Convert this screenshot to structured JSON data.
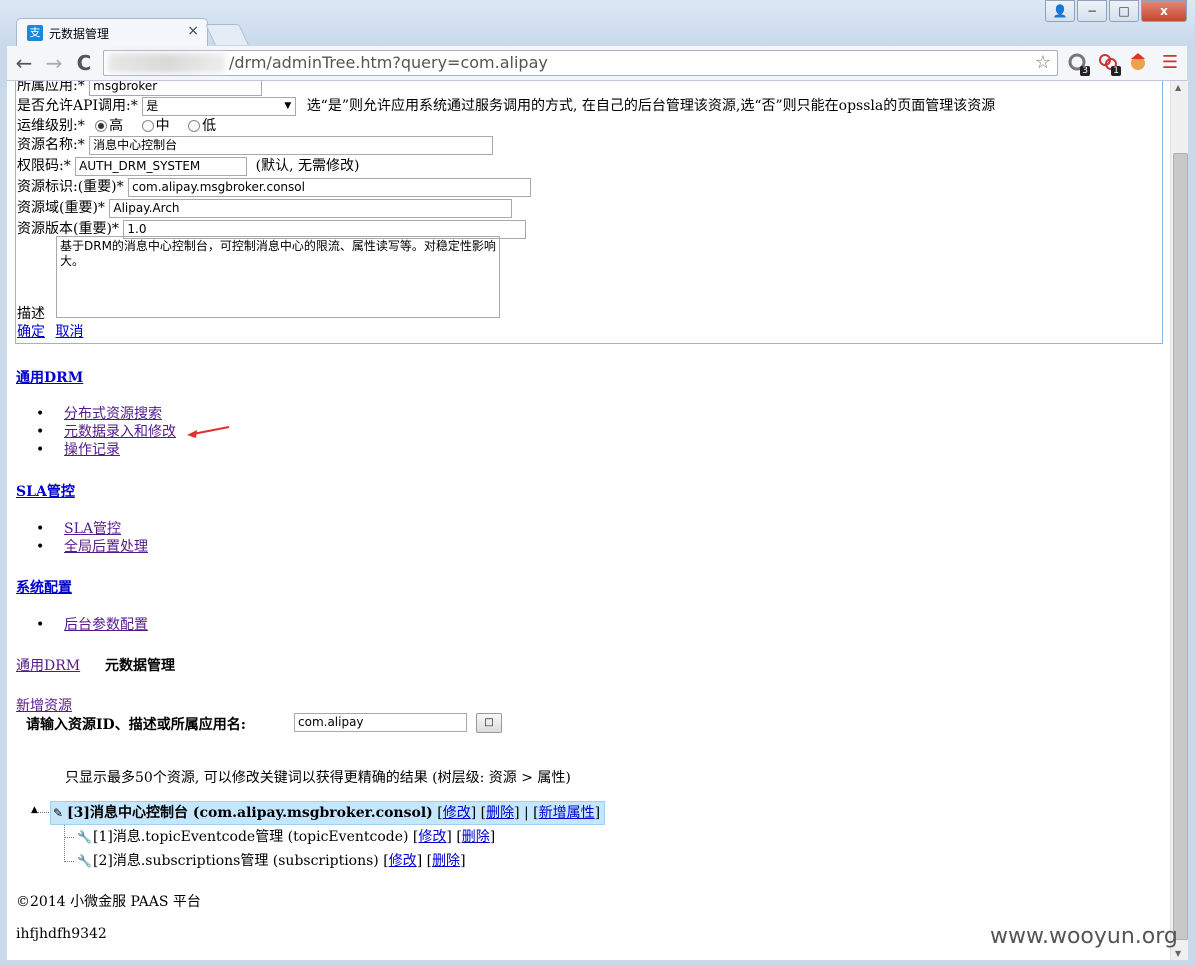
{
  "browser": {
    "tab_title": "元数据管理",
    "tab_close": "×",
    "favicon_glyph": "支",
    "url_text": "/drm/adminTree.htm?query=com.alipay",
    "back_glyph": "←",
    "forward_glyph": "→",
    "reload_glyph": "C",
    "star_glyph": "☆",
    "menu_glyph": "☰",
    "ext_badges": [
      "3",
      "1"
    ],
    "window_controls": {
      "account": "👤",
      "minimize": "−",
      "maximize": "□",
      "close": "x"
    }
  },
  "form": {
    "app_label": "所属应用:*",
    "app_value": "msgbroker",
    "api_label": "是否允许API调用:*",
    "api_selected": "是",
    "api_note": "选“是”则允许应用系统通过服务调用的方式, 在自己的后台管理该资源,选“否”则只能在opssla的页面管理该资源",
    "level_label": "运维级别:*",
    "level_options": [
      "高",
      "中",
      "低"
    ],
    "level_selected_index": 0,
    "name_label": "资源名称:*",
    "name_value": "消息中心控制台",
    "perm_label": "权限码:*",
    "perm_value": "AUTH_DRM_SYSTEM",
    "perm_note": "(默认, 无需修改)",
    "id_label": "资源标识:(重要)*",
    "id_value": "com.alipay.msgbroker.consol",
    "domain_label": "资源域(重要)*",
    "domain_value": "Alipay.Arch",
    "version_label": "资源版本(重要)*",
    "version_value": "1.0",
    "desc_label": "描述",
    "desc_value": "基于DRM的消息中心控制台，可控制消息中心的限流、属性读写等。对稳定性影响大。",
    "confirm": "确定",
    "cancel": "取消"
  },
  "nav": {
    "drm_title": "通用DRM",
    "drm_items": [
      "分布式资源搜索",
      "元数据录入和修改",
      "操作记录"
    ],
    "sla_title": "SLA管控",
    "sla_items": [
      "SLA管控",
      "全局后置处理"
    ],
    "sys_title": "系统配置",
    "sys_items": [
      "后台参数配置"
    ]
  },
  "breadcrumb": {
    "parent": "通用DRM",
    "current": "元数据管理"
  },
  "search": {
    "new_resource": "新增资源",
    "label": "请输入资源ID、描述或所属应用名:",
    "value": "com.alipay",
    "button": "□",
    "hint": "只显示最多50个资源, 可以修改关键词以获得更精确的结果 (树层级: 资源 > 属性)"
  },
  "tree": {
    "root": {
      "text": "[3]消息中心控制台 (com.alipay.msgbroker.consol)",
      "edit": "修改",
      "delete": "删除",
      "add_prop": "新增属性"
    },
    "children": [
      {
        "text": "[1]消息.topicEventcode管理 (topicEventcode)",
        "edit": "修改",
        "delete": "删除"
      },
      {
        "text": "[2]消息.subscriptions管理 (subscriptions)",
        "edit": "修改",
        "delete": "删除"
      }
    ]
  },
  "footer": {
    "copyright": "©2014 小微金服 PAAS 平台",
    "user": "ihfjhdfh9342"
  },
  "watermark": "www.wooyun.org"
}
